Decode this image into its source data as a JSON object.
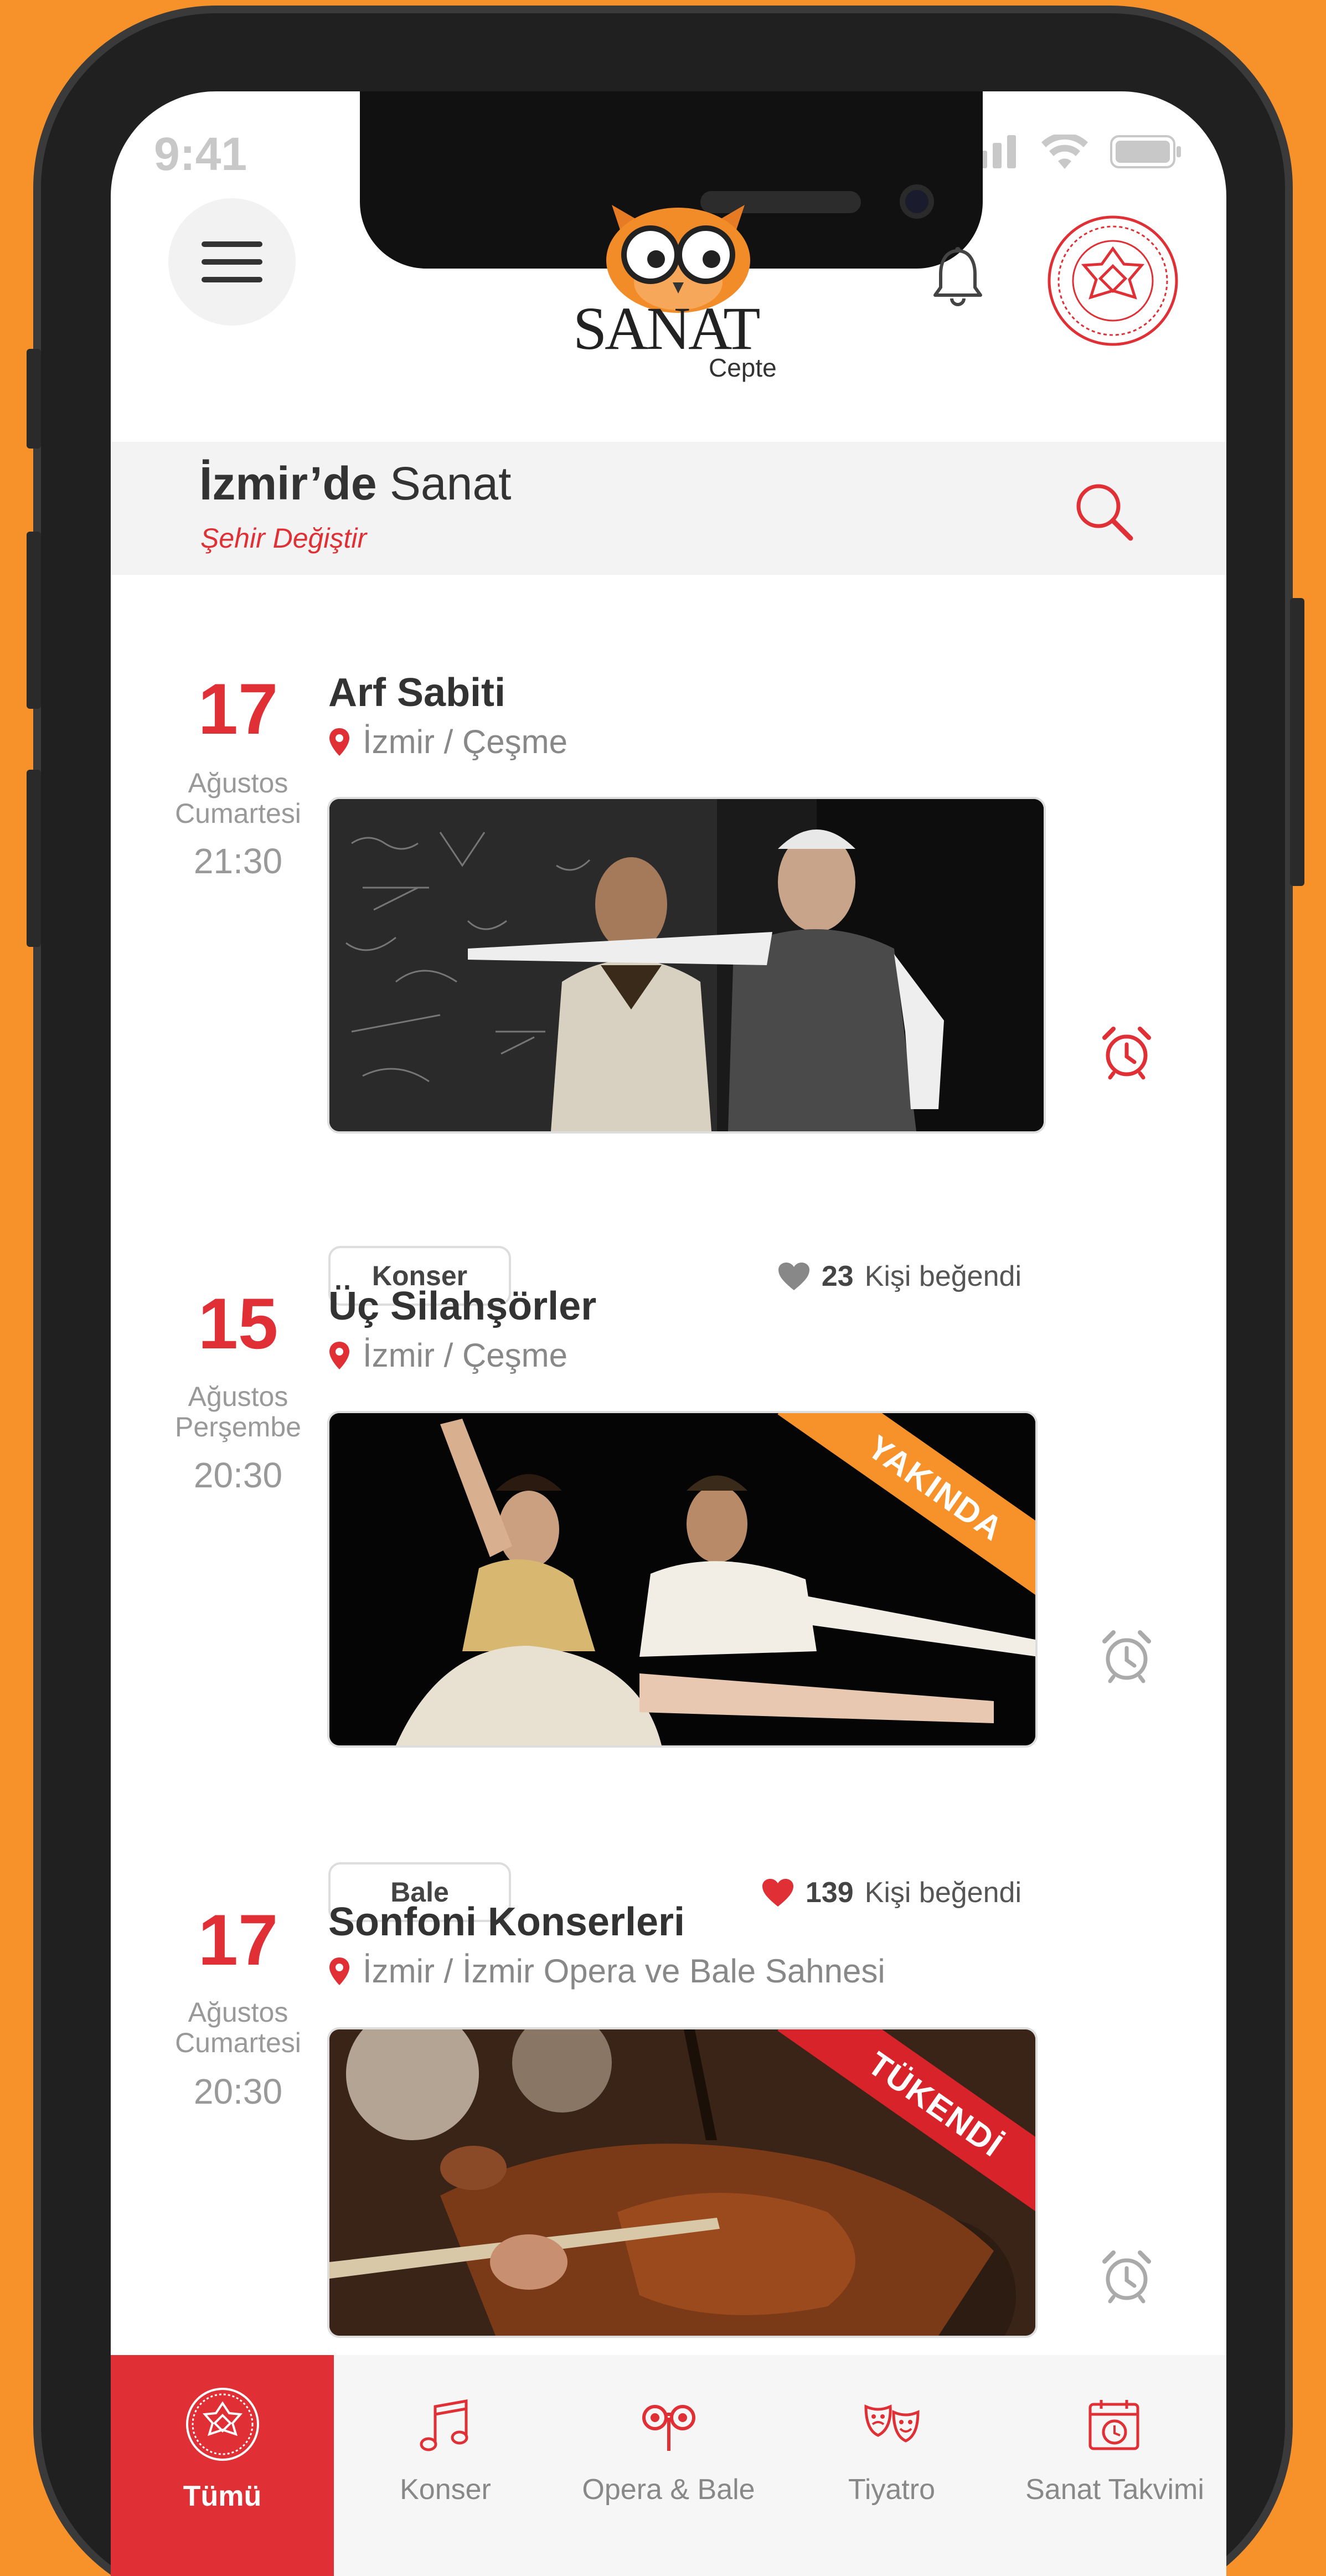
{
  "status": {
    "time": "9:41"
  },
  "header": {
    "logo_text": "SANAT",
    "logo_sub": "Cepte"
  },
  "city": {
    "bold": "İzmir’de",
    "regular": " Sanat",
    "change_label": "Şehir Değiştir"
  },
  "events": [
    {
      "day": "17",
      "month": "Ağustos",
      "weekday": "Cumartesi",
      "time": "21:30",
      "title": "Arf Sabiti",
      "location": "İzmir / Çeşme",
      "category": "Konser",
      "likes": "23",
      "likes_label": "Kişi beğendi",
      "liked": false,
      "badge": "",
      "alarm_active": true
    },
    {
      "day": "15",
      "month": "Ağustos",
      "weekday": "Perşembe",
      "time": "20:30",
      "title": "Üç Silahşörler",
      "location": "İzmir / Çeşme",
      "category": "Bale",
      "likes": "139",
      "likes_label": "Kişi beğendi",
      "liked": true,
      "badge": "YAKINDA",
      "alarm_active": false
    },
    {
      "day": "17",
      "month": "Ağustos",
      "weekday": "Cumartesi",
      "time": "20:30",
      "title": "Sonfoni Konserleri",
      "location": "İzmir / İzmir Opera ve Bale Sahnesi",
      "badge": "TÜKENDİ",
      "alarm_active": false
    }
  ],
  "nav": [
    {
      "label": "Tümü",
      "icon": "emblem-icon"
    },
    {
      "label": "Konser",
      "icon": "music-note-icon"
    },
    {
      "label": "Opera & Bale",
      "icon": "opera-glasses-icon"
    },
    {
      "label": "Tiyatro",
      "icon": "theater-masks-icon"
    },
    {
      "label": "Sanat Takvimi",
      "icon": "calendar-clock-icon"
    }
  ],
  "colors": {
    "accent": "#E03036",
    "background": "#F7922A",
    "ribbon_soon": "#F7922A",
    "ribbon_sold_out": "#D9232B"
  }
}
